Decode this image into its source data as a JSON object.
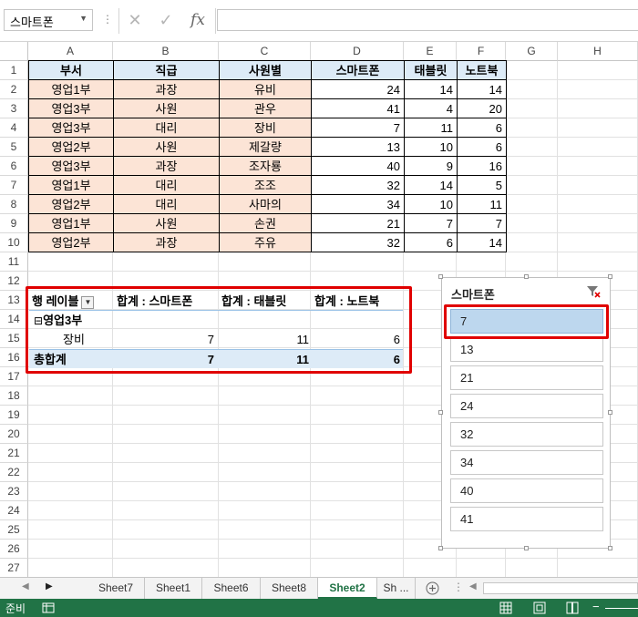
{
  "formula_bar": {
    "name_box": "스마트폰",
    "fx_label": "fx",
    "formula": ""
  },
  "columns": [
    "A",
    "B",
    "C",
    "D",
    "E",
    "F",
    "G",
    "H"
  ],
  "rows": [
    "1",
    "2",
    "3",
    "4",
    "5",
    "6",
    "7",
    "8",
    "9",
    "10",
    "11",
    "12",
    "13",
    "14",
    "15",
    "16",
    "17",
    "18",
    "19",
    "20",
    "21",
    "22",
    "23",
    "24",
    "25",
    "26",
    "27"
  ],
  "table": {
    "headers": [
      "부서",
      "직급",
      "사원별",
      "스마트폰",
      "태블릿",
      "노트북"
    ],
    "data": [
      [
        "영업1부",
        "과장",
        "유비",
        "24",
        "14",
        "14"
      ],
      [
        "영업3부",
        "사원",
        "관우",
        "41",
        "4",
        "20"
      ],
      [
        "영업3부",
        "대리",
        "장비",
        "7",
        "11",
        "6"
      ],
      [
        "영업2부",
        "사원",
        "제갈량",
        "13",
        "10",
        "6"
      ],
      [
        "영업3부",
        "과장",
        "조자룡",
        "40",
        "9",
        "16"
      ],
      [
        "영업1부",
        "대리",
        "조조",
        "32",
        "14",
        "5"
      ],
      [
        "영업2부",
        "대리",
        "사마의",
        "34",
        "10",
        "11"
      ],
      [
        "영업1부",
        "사원",
        "손권",
        "21",
        "7",
        "7"
      ],
      [
        "영업2부",
        "과장",
        "주유",
        "32",
        "6",
        "14"
      ]
    ]
  },
  "pivot": {
    "row_label": "행 레이블",
    "headers": [
      "합계 : 스마트폰",
      "합계 : 태블릿",
      "합계 : 노트북"
    ],
    "group": "영업3부",
    "group_toggle": "⊟",
    "item": {
      "label": "장비",
      "values": [
        "7",
        "11",
        "6"
      ]
    },
    "total": {
      "label": "총합계",
      "values": [
        "7",
        "11",
        "6"
      ]
    }
  },
  "slicer": {
    "title": "스마트폰",
    "items": [
      "7",
      "13",
      "21",
      "24",
      "32",
      "34",
      "40",
      "41"
    ],
    "selected": "7"
  },
  "sheet_tabs": [
    "Sheet7",
    "Sheet1",
    "Sheet6",
    "Sheet8",
    "Sheet2",
    "Sh ..."
  ],
  "active_sheet": "Sheet2",
  "status": {
    "ready": "준비"
  },
  "colors": {
    "accent": "#217346",
    "highlight": "#e00000",
    "header_fill": "#ddebf7",
    "pink_fill": "#fce4d6",
    "slicer_selected": "#bdd7ee"
  }
}
